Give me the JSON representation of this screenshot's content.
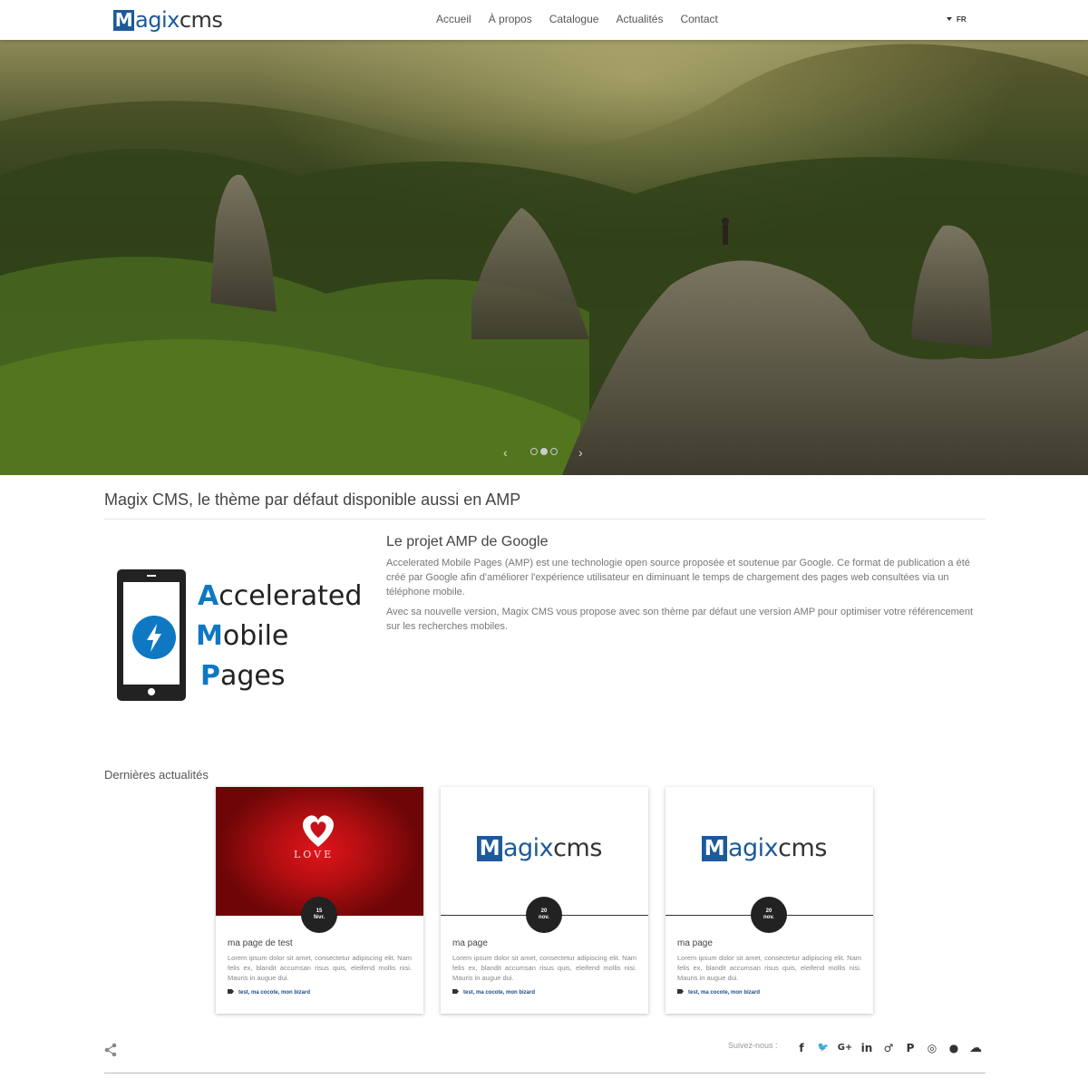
{
  "header": {
    "logo": {
      "m": "M",
      "agix": "agix",
      "cms": "cms"
    },
    "nav": [
      "Accueil",
      "À propos",
      "Catalogue",
      "Actualités",
      "Contact"
    ],
    "language": "FR"
  },
  "hero": {
    "prev_glyph": "‹",
    "next_glyph": "›",
    "slide_count": 3,
    "active_slide": 2
  },
  "intro": {
    "title": "Magix CMS, le thème par défaut disponible aussi en AMP"
  },
  "amp": {
    "logo_words": [
      {
        "cap": "A",
        "rest": "ccelerated"
      },
      {
        "cap": "M",
        "rest": "obile"
      },
      {
        "cap": "P",
        "rest": "ages"
      }
    ],
    "heading": "Le projet AMP de Google",
    "paragraphs": [
      "Accelerated Mobile Pages (AMP) est une technologie open source proposée et soutenue par Google. Ce format de publication a été créé par Google afin d'améliorer l'expérience utilisateur en diminuant le temps de chargement des pages web consultées via un téléphone mobile.",
      "Avec sa nouvelle version, Magix CMS vous propose avec son thème par défaut une version AMP pour optimiser votre référencement sur les recherches mobiles."
    ]
  },
  "news": {
    "title": "Dernières actualités",
    "cards": [
      {
        "image_text": "LOVE",
        "date_day": "15",
        "date_month": "févr.",
        "title": "ma page de test",
        "excerpt": "Lorem ipsum dolor sit amet, consectetur adipiscing elit. Nam felis ex, blandit accumsan risus quis, eleifend mollis nisi. Mauris in augue dui.",
        "tags": "test, ma cocote, mon bizard"
      },
      {
        "date_day": "20",
        "date_month": "nov.",
        "title": "ma page",
        "excerpt": "Lorem ipsum dolor sit amet, consectetur adipiscing elit. Nam felis ex, blandit accumsan risus quis, eleifend mollis nisi. Mauris in augue dui.",
        "tags": "test, ma cocote, mon bizard"
      },
      {
        "date_day": "20",
        "date_month": "nov.",
        "title": "ma page",
        "excerpt": "Lorem ipsum dolor sit amet, consectetur adipiscing elit. Nam felis ex, blandit accumsan risus quis, eleifend mollis nisi. Mauris in augue dui.",
        "tags": "test, ma cocote, mon bizard"
      }
    ]
  },
  "footer": {
    "follow_label": "Suivez-nous :",
    "social": [
      {
        "icon": "facebook-icon",
        "glyph": "f"
      },
      {
        "icon": "twitter-icon",
        "glyph": "🐦"
      },
      {
        "icon": "google-plus-icon",
        "glyph": "G+"
      },
      {
        "icon": "linkedin-icon",
        "glyph": "in"
      },
      {
        "icon": "viadeo-icon",
        "glyph": "♂"
      },
      {
        "icon": "pinterest-icon",
        "glyph": "P"
      },
      {
        "icon": "instagram-icon",
        "glyph": "◎"
      },
      {
        "icon": "github-icon",
        "glyph": "●"
      },
      {
        "icon": "soundcloud-icon",
        "glyph": "☁"
      }
    ]
  },
  "colors": {
    "brand_blue": "#1c5a9a",
    "amp_blue": "#0f78c2",
    "date_badge": "#222222"
  }
}
